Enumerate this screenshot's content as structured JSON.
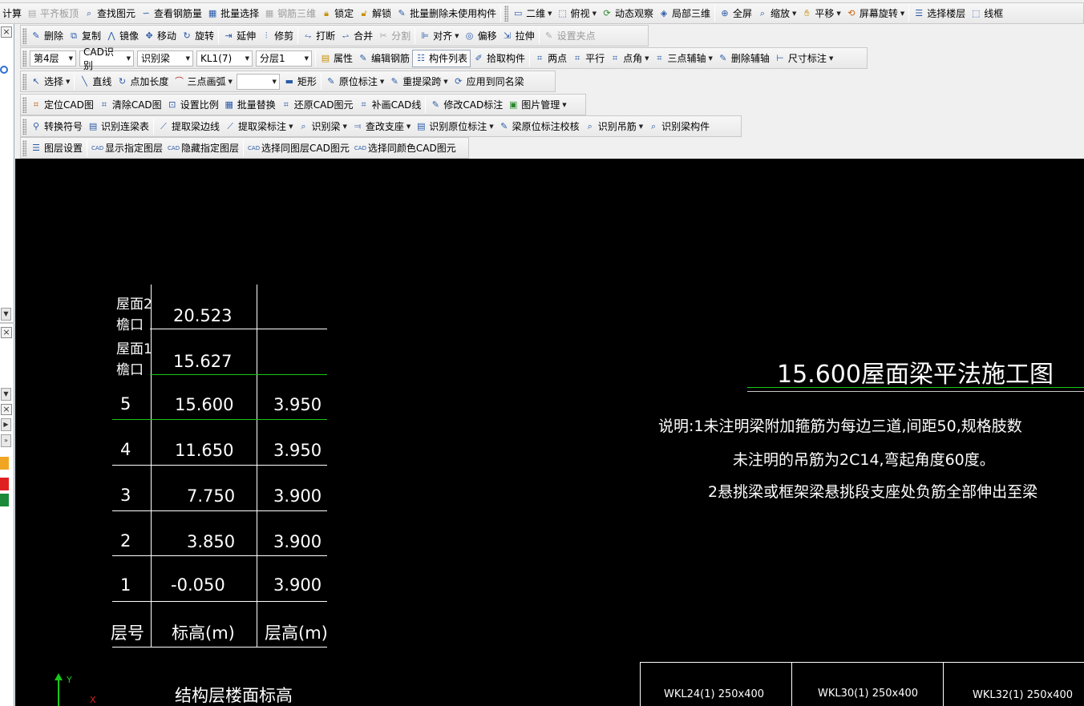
{
  "toolbar1": {
    "items": [
      {
        "label": "计算",
        "icon": "calc-icon",
        "disabled": false
      },
      {
        "label": "平齐板顶",
        "icon": "align-top-icon",
        "disabled": true
      },
      {
        "label": "查找图元",
        "icon": "find-icon",
        "disabled": false
      },
      {
        "label": "查看钢筋量",
        "icon": "rebar-qty-icon",
        "disabled": false
      },
      {
        "label": "批量选择",
        "icon": "batch-select-icon",
        "disabled": false
      },
      {
        "label": "钢筋三维",
        "icon": "rebar-3d-icon",
        "disabled": true
      },
      {
        "label": "锁定",
        "icon": "lock-icon",
        "disabled": false
      },
      {
        "label": "解锁",
        "icon": "unlock-icon",
        "disabled": false
      },
      {
        "label": "批量删除未使用构件",
        "icon": "batch-delete-icon",
        "disabled": false
      },
      {
        "label": "二维",
        "icon": "2d-icon",
        "disabled": false,
        "dropdown": true
      },
      {
        "label": "俯视",
        "icon": "top-view-icon",
        "disabled": false,
        "dropdown": true
      },
      {
        "label": "动态观察",
        "icon": "orbit-icon",
        "disabled": false
      },
      {
        "label": "局部三维",
        "icon": "partial-3d-icon",
        "disabled": false
      },
      {
        "label": "全屏",
        "icon": "fullscreen-icon",
        "disabled": false
      },
      {
        "label": "缩放",
        "icon": "zoom-icon",
        "disabled": false,
        "dropdown": true
      },
      {
        "label": "平移",
        "icon": "pan-icon",
        "disabled": false,
        "dropdown": true
      },
      {
        "label": "屏幕旋转",
        "icon": "screen-rotate-icon",
        "disabled": false,
        "dropdown": true
      },
      {
        "label": "选择楼层",
        "icon": "select-floor-icon",
        "disabled": false
      },
      {
        "label": "线框",
        "icon": "wireframe-icon",
        "disabled": false
      }
    ]
  },
  "toolbar2": {
    "items": [
      {
        "label": "删除",
        "icon": "delete-icon",
        "disabled": false
      },
      {
        "label": "复制",
        "icon": "copy-icon",
        "disabled": false
      },
      {
        "label": "镜像",
        "icon": "mirror-icon",
        "disabled": false
      },
      {
        "label": "移动",
        "icon": "move-icon",
        "disabled": false
      },
      {
        "label": "旋转",
        "icon": "rotate-icon",
        "disabled": false
      },
      {
        "label": "延伸",
        "icon": "extend-icon",
        "disabled": false
      },
      {
        "label": "修剪",
        "icon": "trim-icon",
        "disabled": false
      },
      {
        "label": "打断",
        "icon": "break-icon",
        "disabled": false
      },
      {
        "label": "合并",
        "icon": "merge-icon",
        "disabled": false
      },
      {
        "label": "分割",
        "icon": "split-icon",
        "disabled": true
      },
      {
        "label": "对齐",
        "icon": "align-icon",
        "disabled": false,
        "dropdown": true
      },
      {
        "label": "偏移",
        "icon": "offset-icon",
        "disabled": false
      },
      {
        "label": "拉伸",
        "icon": "stretch-icon",
        "disabled": false
      },
      {
        "label": "设置夹点",
        "icon": "grip-point-icon",
        "disabled": true
      }
    ]
  },
  "toolbar3": {
    "floor": "第4层",
    "mode": "CAD识别",
    "action": "识别梁",
    "component": "KL1(7)",
    "layer": "分层1",
    "items": [
      {
        "label": "属性",
        "icon": "property-icon"
      },
      {
        "label": "编辑钢筋",
        "icon": "edit-rebar-icon"
      },
      {
        "label": "构件列表",
        "icon": "component-list-icon",
        "pressed": true
      },
      {
        "label": "拾取构件",
        "icon": "pick-component-icon"
      },
      {
        "label": "两点",
        "icon": "two-point-icon"
      },
      {
        "label": "平行",
        "icon": "parallel-icon"
      },
      {
        "label": "点角",
        "icon": "point-angle-icon",
        "dropdown": true
      },
      {
        "label": "三点辅轴",
        "icon": "three-point-axis-icon",
        "dropdown": true
      },
      {
        "label": "删除辅轴",
        "icon": "delete-axis-icon"
      },
      {
        "label": "尺寸标注",
        "icon": "dimension-icon",
        "dropdown": true
      }
    ]
  },
  "toolbar4": {
    "select_label": "选择",
    "items": [
      {
        "label": "直线",
        "icon": "line-icon"
      },
      {
        "label": "点加长度",
        "icon": "point-length-icon"
      },
      {
        "label": "三点画弧",
        "icon": "arc-icon",
        "dropdown": true
      }
    ],
    "blank_combo": "",
    "items2": [
      {
        "label": "矩形",
        "icon": "rectangle-icon"
      },
      {
        "label": "原位标注",
        "icon": "in-situ-mark-icon",
        "dropdown": true
      },
      {
        "label": "重提梁跨",
        "icon": "re-extract-span-icon",
        "dropdown": true
      },
      {
        "label": "应用到同名梁",
        "icon": "apply-same-beam-icon"
      }
    ]
  },
  "toolbar5": {
    "items": [
      {
        "label": "定位CAD图",
        "icon": "locate-cad-icon"
      },
      {
        "label": "清除CAD图",
        "icon": "clear-cad-icon"
      },
      {
        "label": "设置比例",
        "icon": "set-scale-icon"
      },
      {
        "label": "批量替换",
        "icon": "batch-replace-icon"
      },
      {
        "label": "还原CAD图元",
        "icon": "restore-cad-icon"
      },
      {
        "label": "补画CAD线",
        "icon": "draw-cad-line-icon"
      },
      {
        "label": "修改CAD标注",
        "icon": "edit-cad-mark-icon"
      },
      {
        "label": "图片管理",
        "icon": "image-manage-icon",
        "dropdown": true
      }
    ]
  },
  "toolbar6": {
    "items": [
      {
        "label": "转换符号",
        "icon": "convert-symbol-icon"
      },
      {
        "label": "识别连梁表",
        "icon": "recognize-beam-table-icon"
      },
      {
        "label": "提取梁边线",
        "icon": "extract-beam-edge-icon"
      },
      {
        "label": "提取梁标注",
        "icon": "extract-beam-mark-icon",
        "dropdown": true
      },
      {
        "label": "识别梁",
        "icon": "recognize-beam-icon",
        "dropdown": true
      },
      {
        "label": "查改支座",
        "icon": "edit-support-icon",
        "dropdown": true
      },
      {
        "label": "识别原位标注",
        "icon": "recognize-in-situ-icon",
        "dropdown": true
      },
      {
        "label": "梁原位标注校核",
        "icon": "check-in-situ-icon"
      },
      {
        "label": "识别吊筋",
        "icon": "recognize-hanger-icon",
        "dropdown": true
      },
      {
        "label": "识别梁构件",
        "icon": "recognize-beam-component-icon"
      }
    ]
  },
  "toolbar7": {
    "items": [
      {
        "label": "图层设置",
        "icon": "layer-settings-icon"
      },
      {
        "label": "显示指定图层",
        "icon": "show-layer-icon"
      },
      {
        "label": "隐藏指定图层",
        "icon": "hide-layer-icon"
      },
      {
        "label": "选择同图层CAD图元",
        "icon": "select-same-layer-icon"
      },
      {
        "label": "选择同颜色CAD图元",
        "icon": "select-same-color-icon"
      }
    ]
  },
  "canvas": {
    "table": {
      "rows": [
        {
          "label": "屋面2",
          "label2": "檐口",
          "elev": "20.523",
          "height": ""
        },
        {
          "label": "屋面1",
          "label2": "檐口",
          "elev": "15.627",
          "height": ""
        },
        {
          "label": "5",
          "elev": "15.600",
          "height": "3.950"
        },
        {
          "label": "4",
          "elev": "11.650",
          "height": "3.950"
        },
        {
          "label": "3",
          "elev": "7.750",
          "height": "3.900"
        },
        {
          "label": "2",
          "elev": "3.850",
          "height": "3.900"
        },
        {
          "label": "1",
          "elev": "-0.050",
          "height": "3.900"
        }
      ],
      "header": {
        "floor": "层号",
        "elev": "标高(m)",
        "height": "层高(m)"
      },
      "caption": "结构层楼面标高"
    },
    "title": "15.600屋面梁平法施工图",
    "notes": [
      "说明:1未注明梁附加箍筋为每边三道,间距50,规格肢数",
      "未注明的吊筋为2C14,弯起角度60度。",
      "2悬挑梁或框架梁悬挑段支座处负筋全部伸出至梁"
    ],
    "beam_labels": [
      "WKL24(1) 250x400",
      "WKL30(1) 250x400",
      "WKL32(1) 250x400"
    ],
    "axis": {
      "y": "Y",
      "x": "X"
    },
    "colors": {
      "background": "#000000",
      "text": "#ffffff",
      "green": "#18c818",
      "magenta": "#e000e0"
    }
  }
}
